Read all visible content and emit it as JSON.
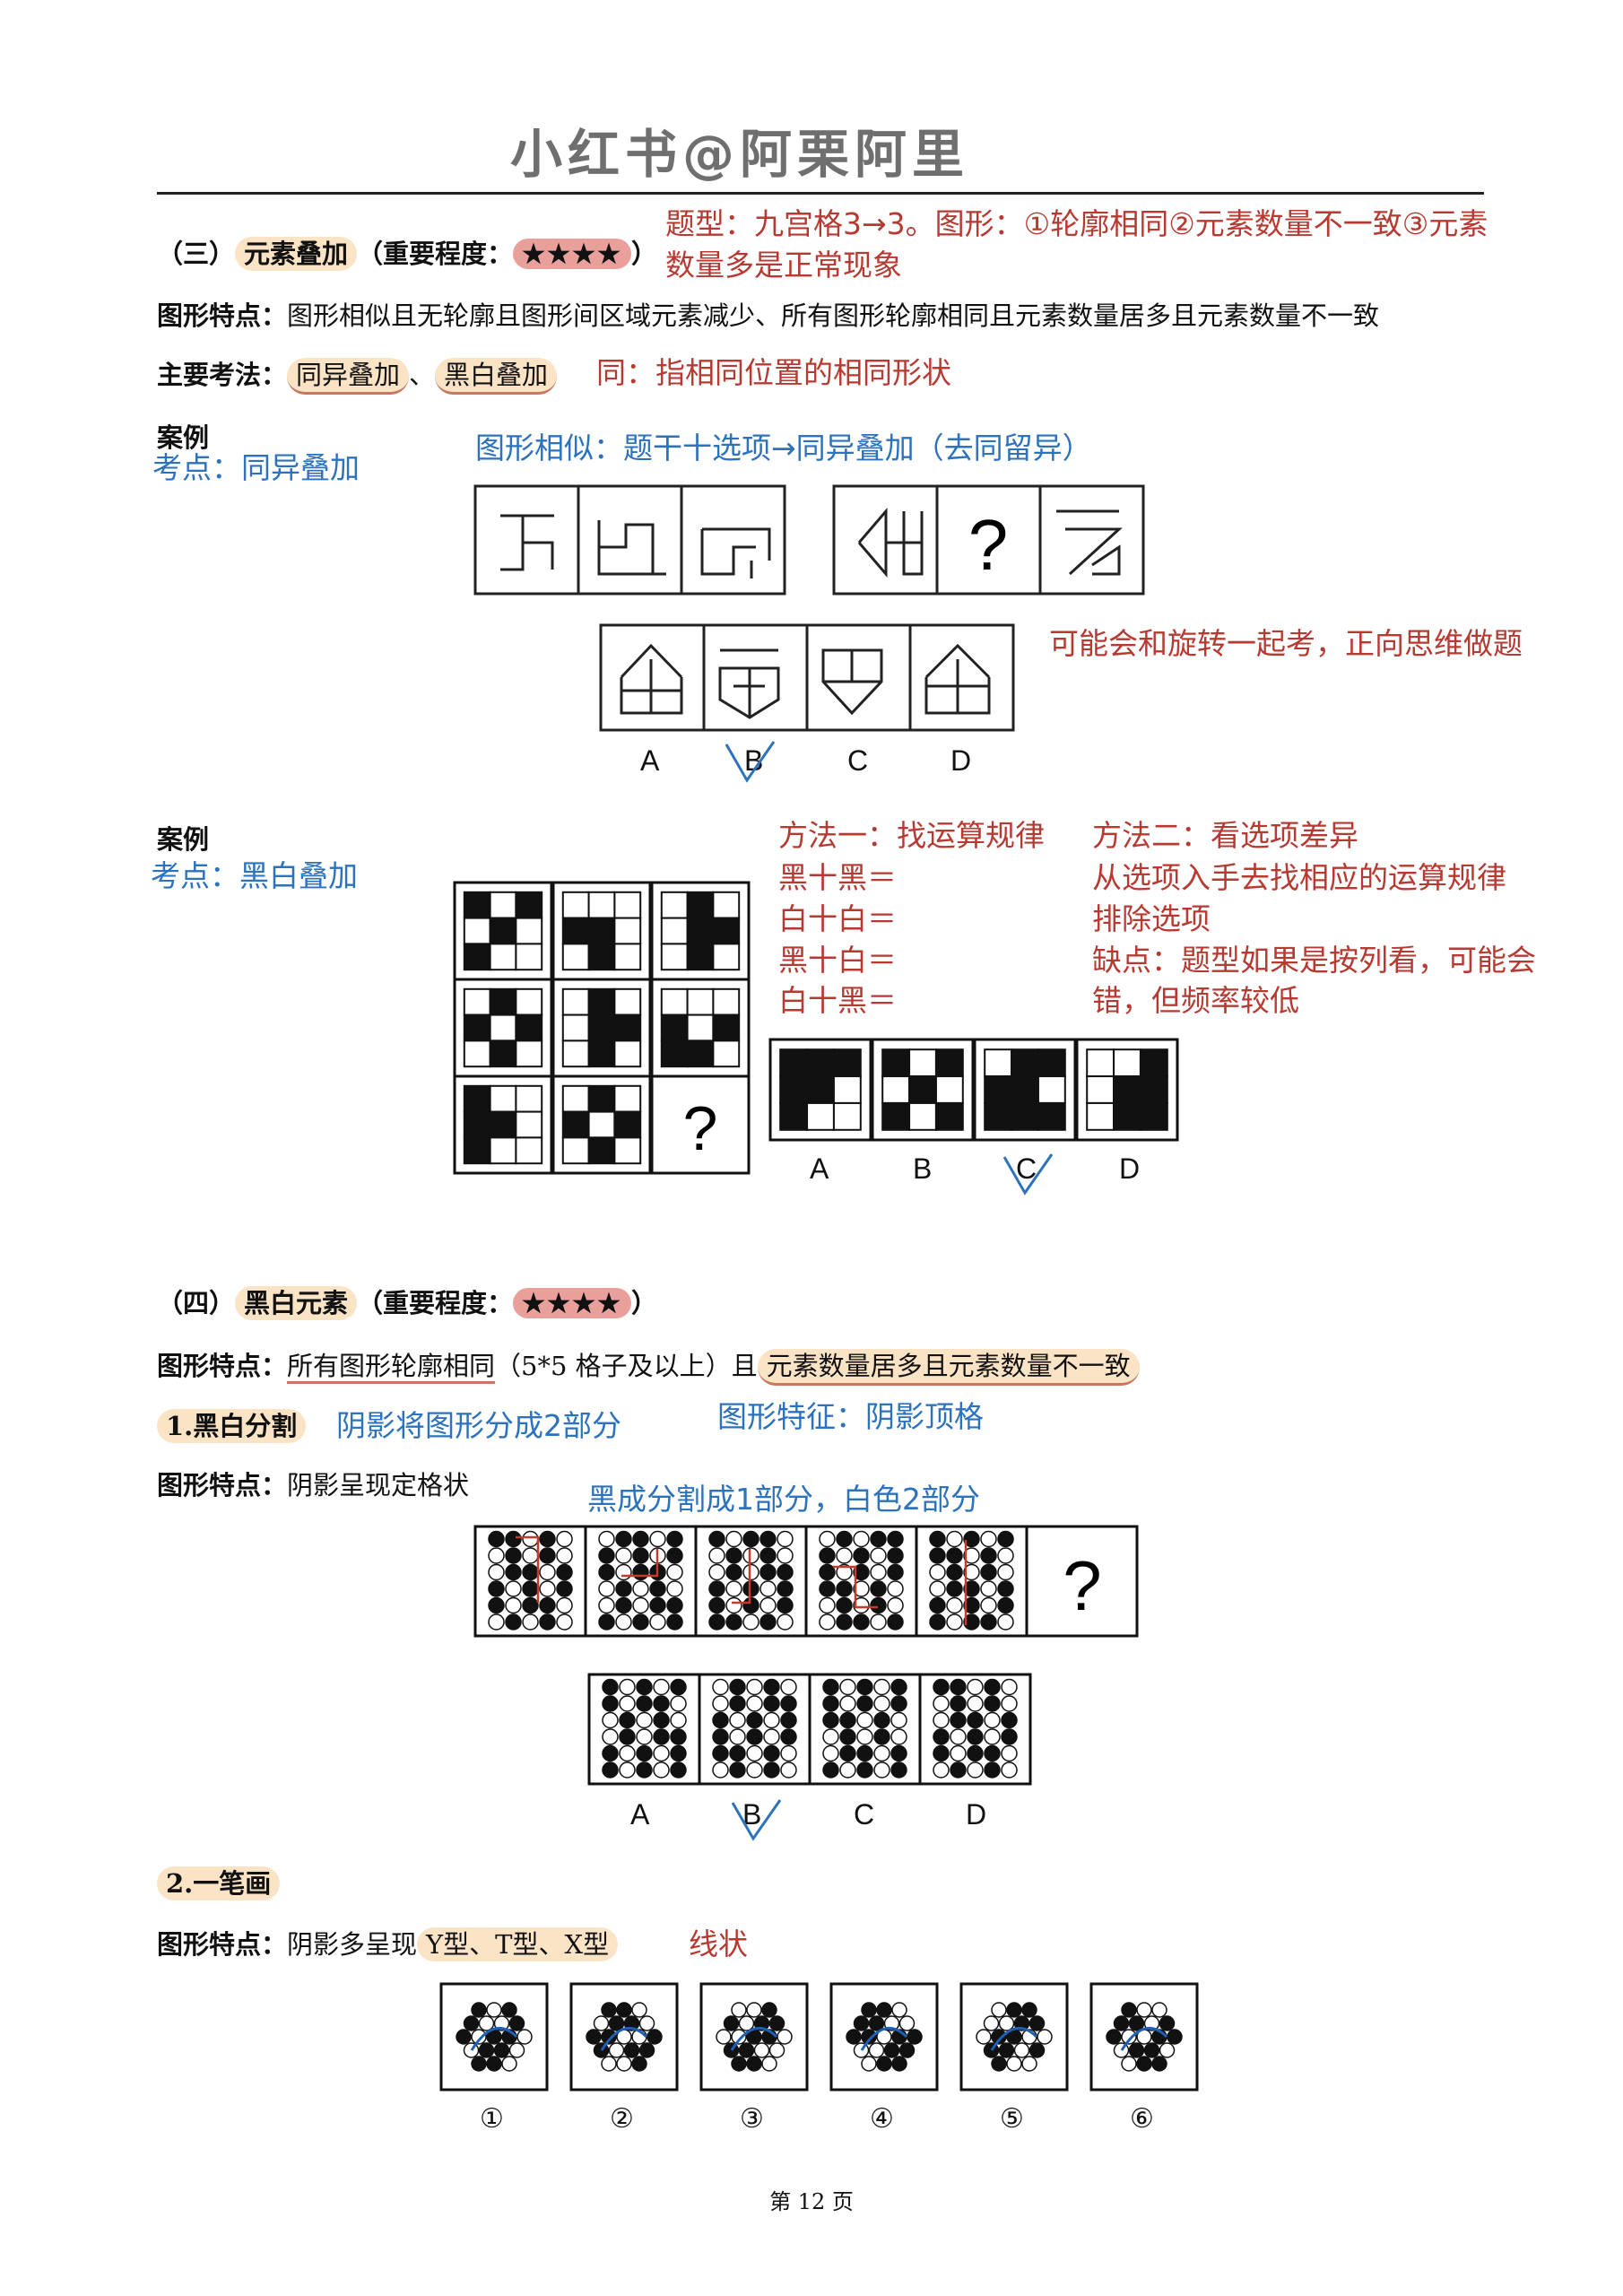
{
  "header": {
    "title": "小红书@阿栗阿里"
  },
  "sec3": {
    "heading_prefix": "（三）",
    "heading_name": "元素叠加",
    "heading_imp": "（重要程度：",
    "heading_stars": "★★★★",
    "heading_close": "）",
    "note_type": "题型：九宫格3→3。图形：①轮廓相同②元素数量不一致③元素",
    "note_type2": "数量多是正常现象",
    "feature_label": "图形特点：",
    "feature_text": "图形相似且无轮廓且图形间区域元素减少、所有图形轮廓相同且元素数量居多且元素数量不一致",
    "method_label": "主要考法：",
    "method_1": "同异叠加",
    "method_sep": "、",
    "method_2": "黑白叠加",
    "method_note": "同：指相同位置的相同形状",
    "case1_label": "案例",
    "case1_point": "考点：同异叠加",
    "case1_note": "图形相似：题干十选项→同异叠加（去同留异）",
    "case1_note2": "可能会和旋转一起考，正向思维做题",
    "case1_options": [
      "A",
      "B",
      "C",
      "D"
    ],
    "case2_label": "案例",
    "case2_point": "考点：黑白叠加",
    "method_one": "方法一：找运算规律",
    "rules": [
      "黑十黑＝",
      "白十白＝",
      "黑十白＝",
      "白十黑＝"
    ],
    "method_two": "方法二：看选项差异",
    "method_two_lines": [
      "从选项入手去找相应的运算规律",
      "排除选项",
      "缺点：题型如果是按列看，可能会",
      "错，但频率较低"
    ],
    "case2_options": [
      "A",
      "B",
      "C",
      "D"
    ]
  },
  "sec4": {
    "heading_prefix": "（四）",
    "heading_name": "黑白元素",
    "heading_imp": "（重要程度：",
    "heading_stars": "★★★★",
    "heading_close": "）",
    "feature_label": "图形特点：",
    "feature_1": "所有图形轮廓相同",
    "feature_2": "（5*5 格子及以上）且",
    "feature_3": "元素数量居多且元素数量不一致",
    "sub1_title": "1.黑白分割",
    "sub1_note": "阴影将图形分成2部分",
    "sub1_note2": "图形特征：阴影顶格",
    "sub1_feature_label": "图形特点：",
    "sub1_feature_text": "阴影呈现定格状",
    "sub1_note3": "黑成分割成1部分，白色2部分",
    "sub1_options": [
      "A",
      "B",
      "C",
      "D"
    ],
    "sub2_title": "2.一笔画",
    "sub2_feature_label": "图形特点：",
    "sub2_feature_text": "阴影多呈现",
    "sub2_shapes": "Y型、T型、X型",
    "sub2_note": "线状",
    "sub2_labels": [
      "①",
      "②",
      "③",
      "④",
      "⑤",
      "⑥"
    ]
  },
  "footer": {
    "page": "第 12 页"
  },
  "colors": {
    "red_note": "#b73a32",
    "blue_note": "#2c72bd",
    "highlight": "#fbe3c6",
    "stars_bg": "#e99f9a"
  }
}
